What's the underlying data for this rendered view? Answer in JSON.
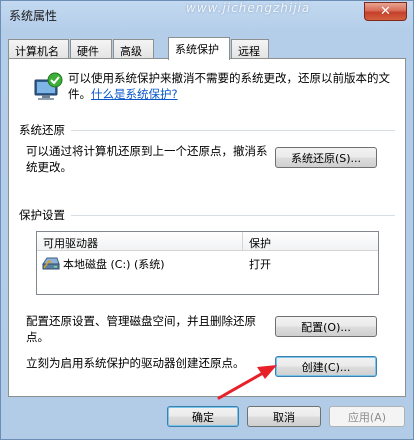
{
  "window": {
    "title": "系统属性",
    "close_glyph": "✕"
  },
  "watermark": "www.jichengzhijia",
  "tabs": [
    {
      "label": "计算机名",
      "active": false
    },
    {
      "label": "硬件",
      "active": false
    },
    {
      "label": "高级",
      "active": false
    },
    {
      "label": "系统保护",
      "active": true
    },
    {
      "label": "远程",
      "active": false
    }
  ],
  "intro": {
    "text": "可以使用系统保护来撤消不需要的系统更改，还原以前版本的文件。",
    "link": "什么是系统保护?"
  },
  "restore_section": {
    "title": "系统还原",
    "description": "可以通过将计算机还原到上一个还原点，撤消系统更改。",
    "button": "系统还原(S)..."
  },
  "protection_section": {
    "title": "保护设置",
    "columns": [
      "可用驱动器",
      "保护"
    ],
    "rows": [
      {
        "drive": "本地磁盘 (C:) (系统)",
        "protection": "打开"
      }
    ],
    "config_text": "配置还原设置、管理磁盘空间，并且删除还原点。",
    "config_button": "配置(O)...",
    "create_text": "立刻为启用系统保护的驱动器创建还原点。",
    "create_button": "创建(C)..."
  },
  "footer": {
    "ok": "确定",
    "cancel": "取消",
    "apply": "应用(A)"
  },
  "colors": {
    "accent_link": "#0b57c9",
    "arrow": "#e8202a",
    "close": "#c4402a"
  },
  "icons": {
    "shield": "shield-computer-icon",
    "drive": "hard-drive-icon",
    "arrow": "red-pointer-arrow"
  }
}
